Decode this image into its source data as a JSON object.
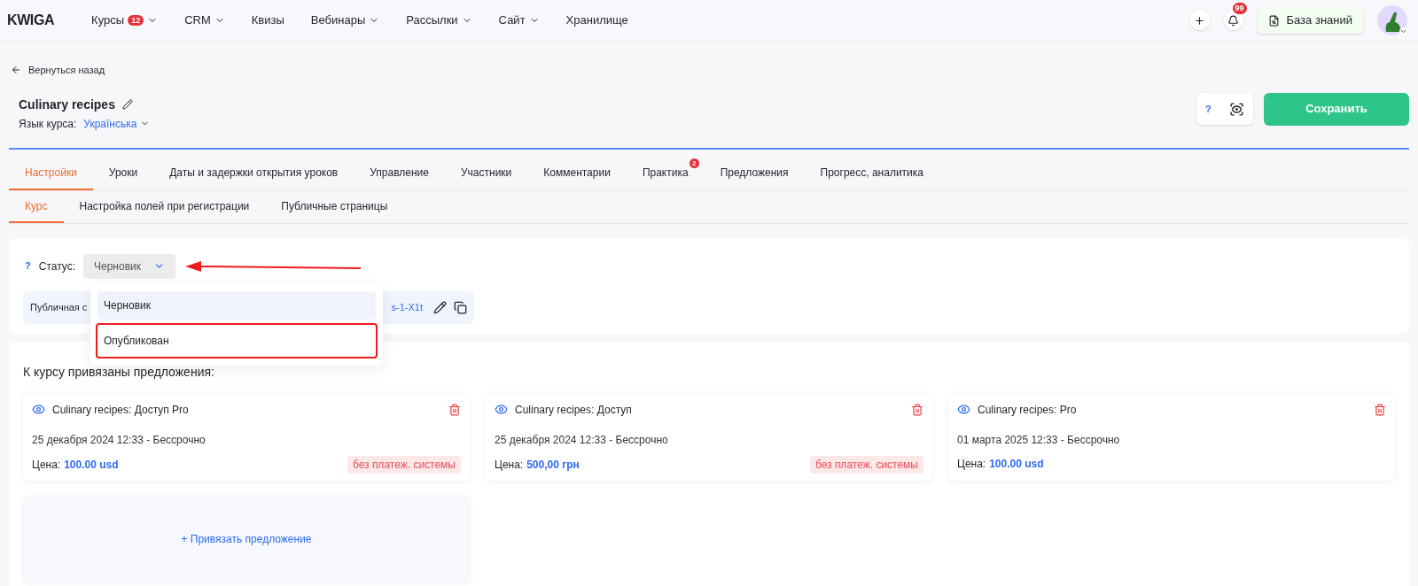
{
  "nav": {
    "logo": "KWIGA",
    "items": [
      {
        "label": "Курсы",
        "badge": "12",
        "dropdown": true
      },
      {
        "label": "CRM",
        "dropdown": true
      },
      {
        "label": "Квизы",
        "dropdown": false
      },
      {
        "label": "Вебинары",
        "dropdown": true
      },
      {
        "label": "Рассылки",
        "dropdown": true
      },
      {
        "label": "Сайт",
        "dropdown": true
      },
      {
        "label": "Хранилище",
        "dropdown": false
      }
    ],
    "notifications": "99",
    "knowledge_base": "База знаний"
  },
  "back": "Вернуться назад",
  "course": {
    "title": "Culinary recipes",
    "language_label": "Язык курса:",
    "language": "Українська",
    "help": "?",
    "save": "Сохранить"
  },
  "tabs": [
    {
      "label": "Настройки",
      "selected": true
    },
    {
      "label": "Уроки",
      "selected": false
    },
    {
      "label": "Даты и задержки открытия уроков",
      "selected": false
    },
    {
      "label": "Управление",
      "selected": false
    },
    {
      "label": "Участники",
      "selected": false
    },
    {
      "label": "Комментарии",
      "selected": false
    },
    {
      "label": "Практика",
      "selected": false,
      "badge": "2"
    },
    {
      "label": "Предложения",
      "selected": false
    },
    {
      "label": "Прогресс, аналитика",
      "selected": false
    }
  ],
  "subtabs": [
    {
      "label": "Курс",
      "selected": true
    },
    {
      "label": "Настройка полей при регистрации",
      "selected": false
    },
    {
      "label": "Публичные страницы",
      "selected": false
    }
  ],
  "status": {
    "help": "?",
    "label": "Статус:",
    "value": "Черновик",
    "options": [
      {
        "label": "Черновик",
        "selected": true,
        "outlined": false
      },
      {
        "label": "Опубликован",
        "selected": false,
        "outlined": true
      }
    ]
  },
  "public_page": {
    "label": "Публичная с",
    "link": "s-1-X1t"
  },
  "offers": {
    "heading": "К курсу привязаны предложения:",
    "add": "+ Привязать предложение",
    "items": [
      {
        "title": "Culinary recipes: Доступ Pro",
        "dates": "25 декабря 2024 12:33 - Бессрочно",
        "price_label": "Цена:",
        "price": "100.00 usd",
        "tag": "без платеж. системы"
      },
      {
        "title": "Culinary recipes: Доступ",
        "dates": "25 декабря 2024 12:33 - Бессрочно",
        "price_label": "Цена:",
        "price": "500,00 грн",
        "tag": "без платеж. системы"
      },
      {
        "title": "Culinary recipes: Pro",
        "dates": "01 марта 2025 12:33 - Бессрочно",
        "price_label": "Цена:",
        "price": "100.00 usd"
      }
    ]
  }
}
